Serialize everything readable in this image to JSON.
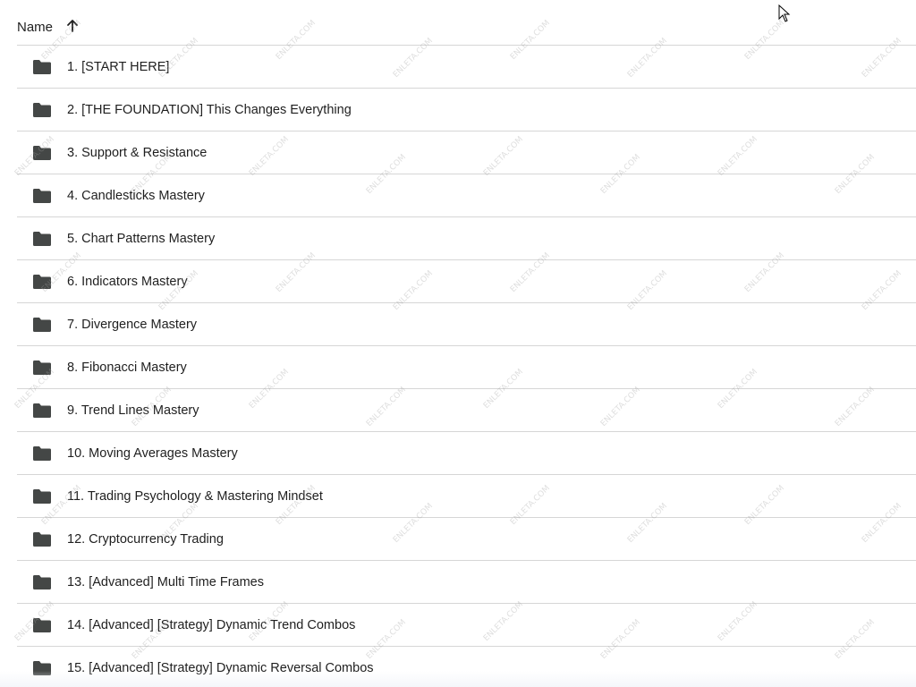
{
  "header": {
    "name_label": "Name",
    "sort_icon": "arrow-up-icon"
  },
  "folders": [
    {
      "label": "1. [START HERE]"
    },
    {
      "label": "2. [THE FOUNDATION] This Changes Everything"
    },
    {
      "label": "3. Support & Resistance"
    },
    {
      "label": "4. Candlesticks Mastery"
    },
    {
      "label": "5. Chart Patterns Mastery"
    },
    {
      "label": "6. Indicators Mastery"
    },
    {
      "label": "7. Divergence Mastery"
    },
    {
      "label": "8. Fibonacci Mastery"
    },
    {
      "label": "9. Trend Lines Mastery"
    },
    {
      "label": "10. Moving Averages Mastery"
    },
    {
      "label": "11. Trading Psychology & Mastering Mindset"
    },
    {
      "label": "12. Cryptocurrency Trading"
    },
    {
      "label": "13. [Advanced] Multi Time Frames"
    },
    {
      "label": "14. [Advanced] [Strategy] Dynamic Trend Combos"
    },
    {
      "label": "15. [Advanced] [Strategy] Dynamic Reversal Combos"
    }
  ],
  "watermark": "ENLETA.COM",
  "colors": {
    "text": "#1f1f1f",
    "divider": "#d6d6d6",
    "folder_icon": "#444746"
  }
}
